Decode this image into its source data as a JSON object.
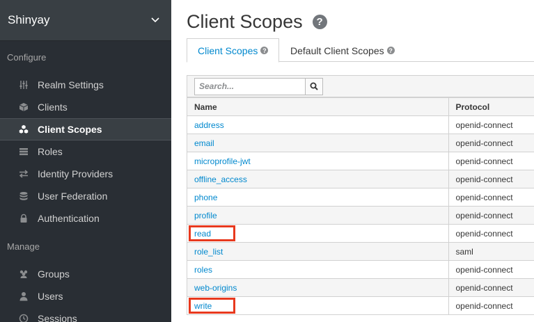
{
  "sidebar": {
    "realm_name": "Shinyay",
    "configure_title": "Configure",
    "configure_items": [
      {
        "label": "Realm Settings",
        "icon": "sliders-icon"
      },
      {
        "label": "Clients",
        "icon": "cube-icon"
      },
      {
        "label": "Client Scopes",
        "icon": "cubes-icon",
        "active": true
      },
      {
        "label": "Roles",
        "icon": "list-icon"
      },
      {
        "label": "Identity Providers",
        "icon": "exchange-icon"
      },
      {
        "label": "User Federation",
        "icon": "database-icon"
      },
      {
        "label": "Authentication",
        "icon": "lock-icon"
      }
    ],
    "manage_title": "Manage",
    "manage_items": [
      {
        "label": "Groups",
        "icon": "users-icon"
      },
      {
        "label": "Users",
        "icon": "user-icon"
      },
      {
        "label": "Sessions",
        "icon": "clock-icon"
      }
    ]
  },
  "main": {
    "title": "Client Scopes",
    "tabs": [
      {
        "label": "Client Scopes",
        "active": true
      },
      {
        "label": "Default Client Scopes",
        "active": false
      }
    ],
    "search": {
      "placeholder": "Search...",
      "value": ""
    },
    "table": {
      "columns": [
        "Name",
        "Protocol"
      ],
      "rows": [
        {
          "name": "address",
          "protocol": "openid-connect",
          "highlighted": false
        },
        {
          "name": "email",
          "protocol": "openid-connect",
          "highlighted": false
        },
        {
          "name": "microprofile-jwt",
          "protocol": "openid-connect",
          "highlighted": false
        },
        {
          "name": "offline_access",
          "protocol": "openid-connect",
          "highlighted": false
        },
        {
          "name": "phone",
          "protocol": "openid-connect",
          "highlighted": false
        },
        {
          "name": "profile",
          "protocol": "openid-connect",
          "highlighted": false
        },
        {
          "name": "read",
          "protocol": "openid-connect",
          "highlighted": true
        },
        {
          "name": "role_list",
          "protocol": "saml",
          "highlighted": false
        },
        {
          "name": "roles",
          "protocol": "openid-connect",
          "highlighted": false
        },
        {
          "name": "web-origins",
          "protocol": "openid-connect",
          "highlighted": false
        },
        {
          "name": "write",
          "protocol": "openid-connect",
          "highlighted": true
        }
      ]
    }
  },
  "colors": {
    "sidebar_bg": "#292e34",
    "link": "#0088ce",
    "highlight": "#e8391e"
  }
}
